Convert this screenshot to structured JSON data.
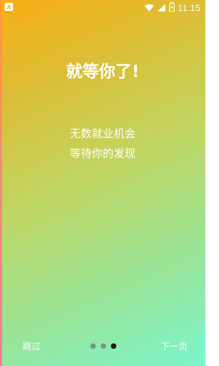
{
  "status_bar": {
    "time": "11:15",
    "icons": [
      "app-notification-icon",
      "wifi-icon",
      "signal-icon",
      "battery-icon"
    ]
  },
  "onboarding": {
    "headline": "就等你了!",
    "description_lines": [
      "无数就业机会",
      "等待你的发现"
    ],
    "skip_label": "跳过",
    "next_label": "下一页",
    "page_indicator": {
      "total_pages": 3,
      "current_page": 3
    }
  },
  "colors": {
    "gradient_start": "#F9AE14",
    "gradient_end": "#7CF5CC",
    "text": "#FFFFFF",
    "dot_active": "#1F1F1F",
    "dot_inactive": "#6B7468"
  }
}
